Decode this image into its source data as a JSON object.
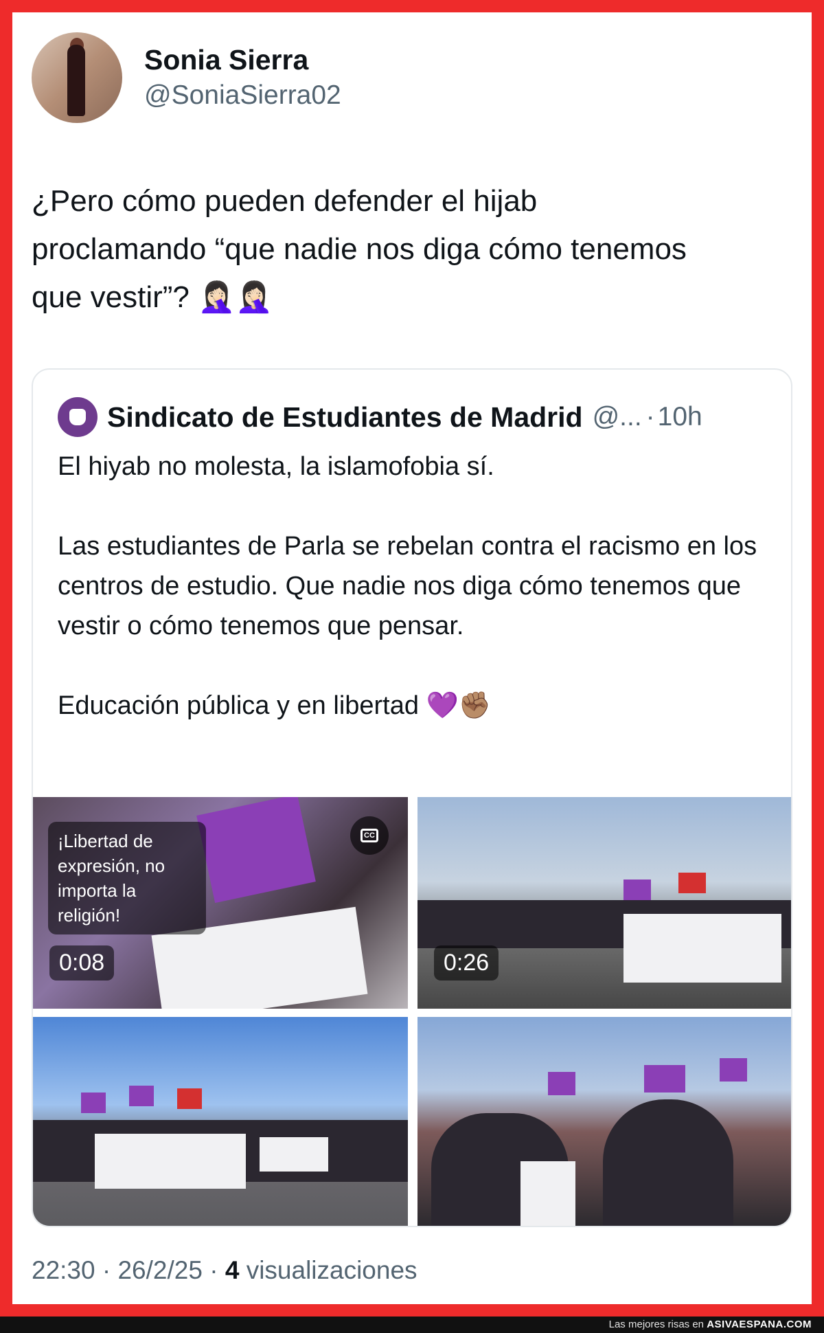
{
  "post": {
    "author_name": "Sonia Sierra",
    "author_handle": "@SoniaSierra02",
    "text": "¿Pero cómo pueden defender el hijab\nproclamando “que nadie nos diga cómo tenemos\nque vestir”? 🤦🏻‍♀️🤦🏻‍♀️",
    "time": "22:30",
    "date": "26/2/25",
    "views_count": "4",
    "views_label": "visualizaciones",
    "separator": "·"
  },
  "quote": {
    "author_name": "Sindicato de Estudiantes de Madrid",
    "author_handle": "@...",
    "separator": "·",
    "time_ago": "10h",
    "paragraphs": [
      "El hiyab no molesta, la islamofobia sí.",
      "Las estudiantes de Parla se rebelan contra el racismo en los centros de estudio. Que nadie nos diga cómo tenemos que vestir o cómo tenemos que pensar.",
      "Educación pública y en libertad 💜✊🏽"
    ],
    "media": [
      {
        "type": "video",
        "duration": "0:08",
        "subtitle": "¡Libertad de expresión, no importa la religión!",
        "cc_icon": "closed-captions-icon"
      },
      {
        "type": "video",
        "duration": "0:26"
      },
      {
        "type": "photo"
      },
      {
        "type": "photo"
      }
    ]
  },
  "watermark": {
    "prefix": "Las mejores risas en",
    "site": "ASIVAESPANA.COM"
  },
  "colors": {
    "frame": "#ee2b2b",
    "text_primary": "#0f1419",
    "text_secondary": "#536471",
    "purple_flag": "#8b3fb6"
  }
}
